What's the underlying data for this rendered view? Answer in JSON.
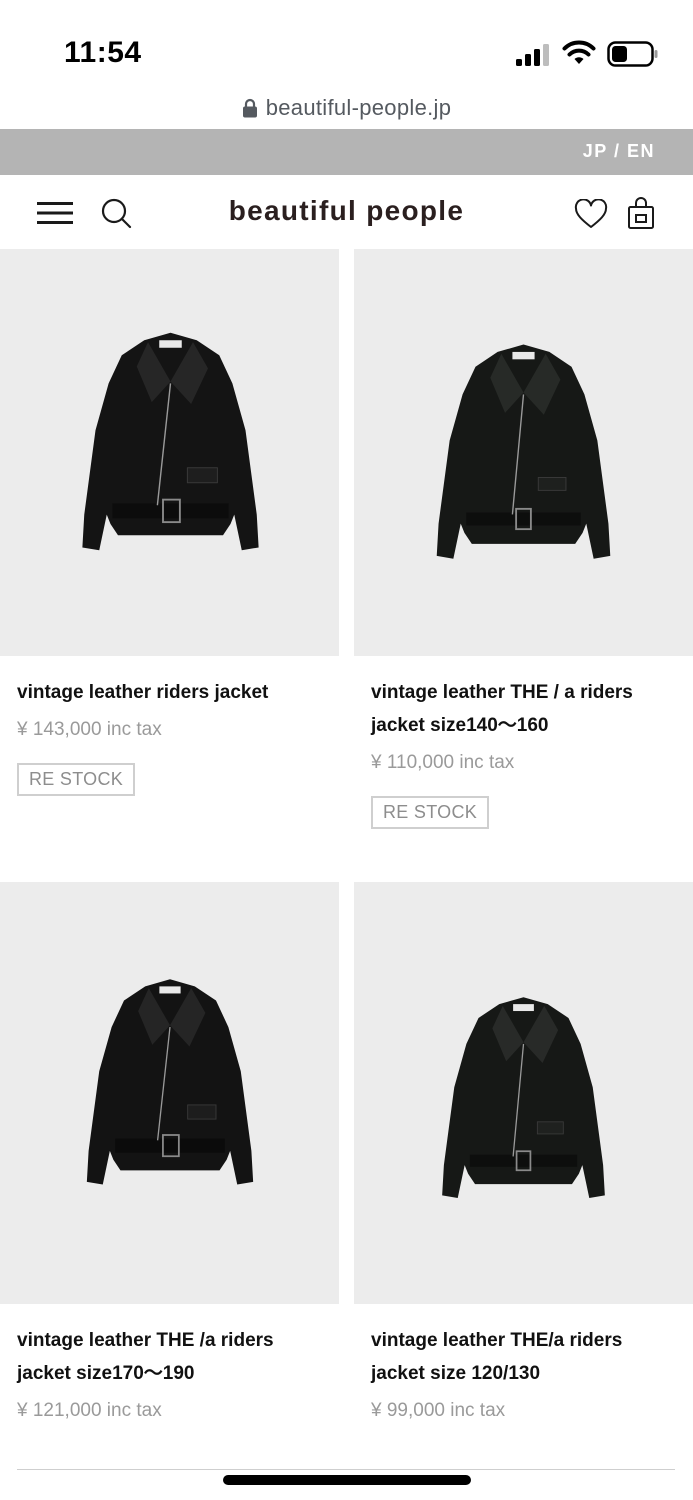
{
  "status_bar": {
    "time": "11:54",
    "icons": [
      "cellular-signal-icon",
      "wifi-icon",
      "battery-icon"
    ]
  },
  "browser": {
    "url": "beautiful-people.jp",
    "lock_icon": "lock-icon"
  },
  "language_bar": {
    "label": "JP / EN"
  },
  "header": {
    "logo": "beautiful people",
    "icons": [
      "hamburger-menu-icon",
      "search-icon",
      "heart-icon",
      "shopping-bag-icon"
    ]
  },
  "products": [
    {
      "name": "vintage leather riders jacket",
      "price": "¥ 143,000 inc tax",
      "badge": "RE STOCK"
    },
    {
      "name": "vintage leather THE / a riders jacket size140〜160",
      "price": "¥ 110,000 inc tax",
      "badge": "RE STOCK"
    },
    {
      "name": "vintage leather THE /a riders jacket size170〜190",
      "price": "¥ 121,000 inc tax",
      "badge": ""
    },
    {
      "name": "vintage leather THE/a riders jacket size 120/130",
      "price": "¥ 99,000 inc tax",
      "badge": ""
    }
  ],
  "colors": {
    "language_bar_bg": "#b4b4b4",
    "image_bg": "#ececec",
    "logo": "#2a1f1f",
    "price": "#9a9a9a"
  }
}
